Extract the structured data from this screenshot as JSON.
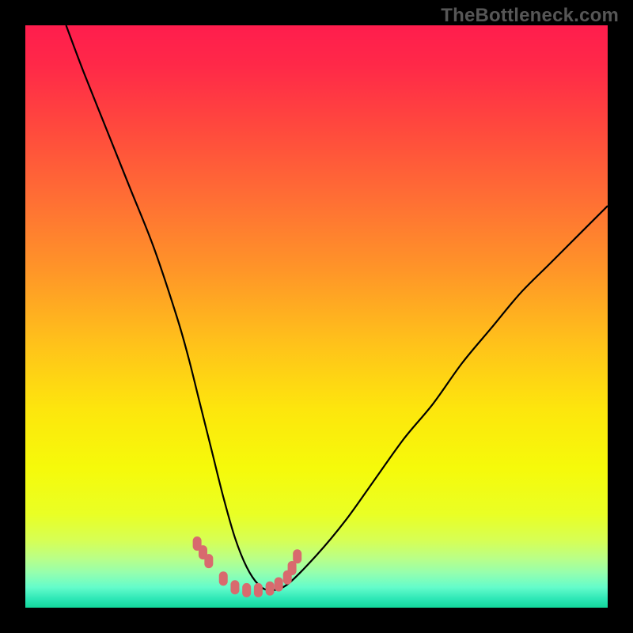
{
  "watermark": "TheBottleneck.com",
  "colors": {
    "black": "#000000",
    "curve": "#000000",
    "marker": "#d86a6e"
  },
  "chart_data": {
    "type": "line",
    "title": "",
    "xlabel": "",
    "ylabel": "",
    "xlim": [
      0,
      100
    ],
    "ylim": [
      0,
      100
    ],
    "grid": false,
    "legend": false,
    "gradient_stops": [
      {
        "pos": 0.0,
        "color": "#ff1d4d"
      },
      {
        "pos": 0.07,
        "color": "#ff2948"
      },
      {
        "pos": 0.18,
        "color": "#ff4a3d"
      },
      {
        "pos": 0.3,
        "color": "#ff6f34"
      },
      {
        "pos": 0.42,
        "color": "#ff9528"
      },
      {
        "pos": 0.55,
        "color": "#ffc31a"
      },
      {
        "pos": 0.66,
        "color": "#fde60d"
      },
      {
        "pos": 0.76,
        "color": "#f6fa0a"
      },
      {
        "pos": 0.84,
        "color": "#e9ff25"
      },
      {
        "pos": 0.885,
        "color": "#d6ff55"
      },
      {
        "pos": 0.915,
        "color": "#baff87"
      },
      {
        "pos": 0.94,
        "color": "#95ffae"
      },
      {
        "pos": 0.965,
        "color": "#64fccb"
      },
      {
        "pos": 0.985,
        "color": "#2de7b6"
      },
      {
        "pos": 1.0,
        "color": "#12d79b"
      }
    ],
    "series": [
      {
        "name": "bottleneck-curve",
        "x": [
          7,
          10,
          14,
          18,
          22,
          26,
          28,
          30,
          32,
          34,
          36,
          38,
          40,
          42,
          45,
          50,
          55,
          60,
          65,
          70,
          75,
          80,
          85,
          90,
          95,
          100
        ],
        "y": [
          100,
          92,
          82,
          72,
          62,
          50,
          43,
          35,
          27,
          19,
          12,
          7,
          4,
          3,
          4,
          9,
          15,
          22,
          29,
          35,
          42,
          48,
          54,
          59,
          64,
          69
        ]
      }
    ],
    "markers": {
      "name": "highlight-band",
      "x": [
        29.5,
        30.5,
        31.5,
        34,
        36,
        38,
        40,
        42,
        43.5,
        45,
        45.8,
        46.7
      ],
      "y": [
        11,
        9.5,
        8,
        5,
        3.5,
        3,
        3,
        3.3,
        4,
        5.2,
        6.8,
        8.8
      ]
    }
  }
}
